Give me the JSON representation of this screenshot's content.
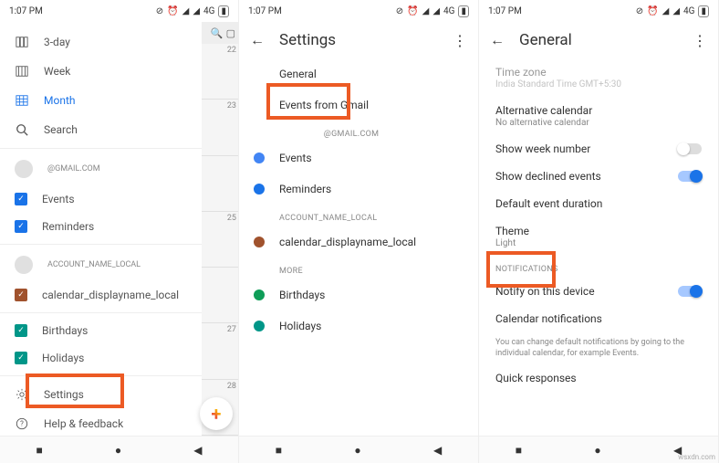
{
  "status": {
    "time": "1:07 PM",
    "network": "4G"
  },
  "screen1": {
    "views": {
      "threeday": "3-day",
      "week": "Week",
      "month": "Month",
      "search": "Search"
    },
    "account1": "@GMAIL.COM",
    "events": "Events",
    "reminders": "Reminders",
    "account2": "ACCOUNT_NAME_LOCAL",
    "calDisplay": "calendar_displayname_local",
    "birthdays": "Birthdays",
    "holidays": "Holidays",
    "settings": "Settings",
    "help": "Help & feedback",
    "days": [
      "22",
      "23",
      "25",
      "27",
      "28"
    ]
  },
  "screen2": {
    "title": "Settings",
    "general": "General",
    "eventsGmail": "Events from Gmail",
    "accountHeader": "@GMAIL.COM",
    "events": "Events",
    "reminders": "Reminders",
    "localHeader": "ACCOUNT_NAME_LOCAL",
    "calDisplay": "calendar_displayname_local",
    "moreHeader": "MORE",
    "birthdays": "Birthdays",
    "holidays": "Holidays"
  },
  "screen3": {
    "title": "General",
    "timezone": {
      "label": "Time zone",
      "value": "India Standard Time  GMT+5:30"
    },
    "altCal": {
      "label": "Alternative calendar",
      "value": "No alternative calendar"
    },
    "weekNum": "Show week number",
    "declined": "Show declined events",
    "duration": "Default event duration",
    "theme": {
      "label": "Theme",
      "value": "Light"
    },
    "notifHeader": "NOTIFICATIONS",
    "notifyDevice": "Notify on this device",
    "calNotif": "Calendar notifications",
    "note": "You can change default notifications by going to the individual calendar, for example Events.",
    "quick": "Quick responses"
  },
  "watermark": "wsxdn.com"
}
